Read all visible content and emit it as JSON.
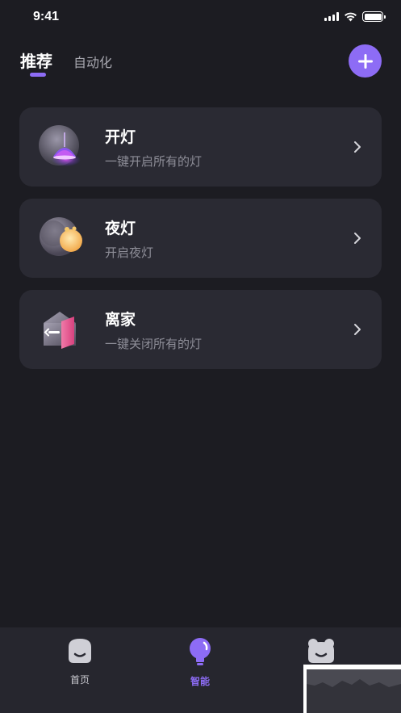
{
  "status_bar": {
    "time": "9:41",
    "icons": [
      "signal-icon",
      "wifi-icon",
      "battery-icon"
    ]
  },
  "header": {
    "tabs": [
      {
        "label": "推荐",
        "active": true
      },
      {
        "label": "自动化",
        "active": false
      }
    ],
    "add_icon": "plus-icon"
  },
  "scenes": [
    {
      "title": "开灯",
      "subtitle": "一键开启所有的灯",
      "icon": "ceiling-lamp-icon"
    },
    {
      "title": "夜灯",
      "subtitle": "开启夜灯",
      "icon": "moon-night-light-icon"
    },
    {
      "title": "离家",
      "subtitle": "一键关闭所有的灯",
      "icon": "leave-home-door-icon"
    }
  ],
  "tab_bar": {
    "items": [
      {
        "label": "首页",
        "icon": "home-face-icon",
        "active": false
      },
      {
        "label": "智能",
        "icon": "bulb-icon",
        "active": true
      },
      {
        "label": "",
        "icon": "profile-face-icon",
        "active": false
      }
    ]
  },
  "colors": {
    "background": "#1c1c22",
    "card": "#2a2a33",
    "accent": "#8d6cf5",
    "subtitle": "#8e8e98"
  }
}
